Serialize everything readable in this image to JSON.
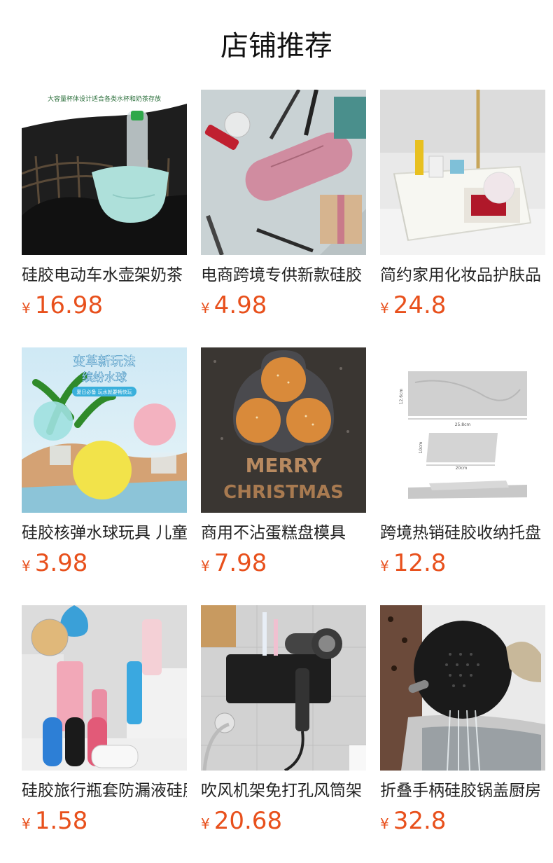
{
  "section_title": "店铺推荐",
  "currency_symbol": "¥",
  "colors": {
    "price": "#e8501c",
    "title": "#111111"
  },
  "products": [
    {
      "name": "硅胶电动车水壶架奶茶",
      "price": "16.98",
      "banner": "大容量杯体设计适合各类水杯和奶茶存放"
    },
    {
      "name": "电商跨境专供新款硅胶",
      "price": "4.98"
    },
    {
      "name": "简约家用化妆品护肤品",
      "price": "24.8"
    },
    {
      "name": "硅胶核弹水球玩具 儿童",
      "price": "3.98",
      "banner": "变革新玩法",
      "banner2": "缤纷水球",
      "banner3": "夏日必备 玩水就要畅快玩"
    },
    {
      "name": "商用不沾蛋糕盘模具",
      "price": "7.98",
      "banner": "MERRY",
      "banner2": "CHRISTMAS"
    },
    {
      "name": "跨境热销硅胶收纳托盘",
      "price": "12.8",
      "dim1": "25.8cm",
      "dim2": "12.6cm",
      "dim3": "20cm",
      "dim4": "10cm"
    },
    {
      "name": "硅胶旅行瓶套防漏液硅胶",
      "price": "1.58"
    },
    {
      "name": "吹风机架免打孔风筒架",
      "price": "20.68"
    },
    {
      "name": "折叠手柄硅胶锅盖厨房",
      "price": "32.8"
    }
  ]
}
